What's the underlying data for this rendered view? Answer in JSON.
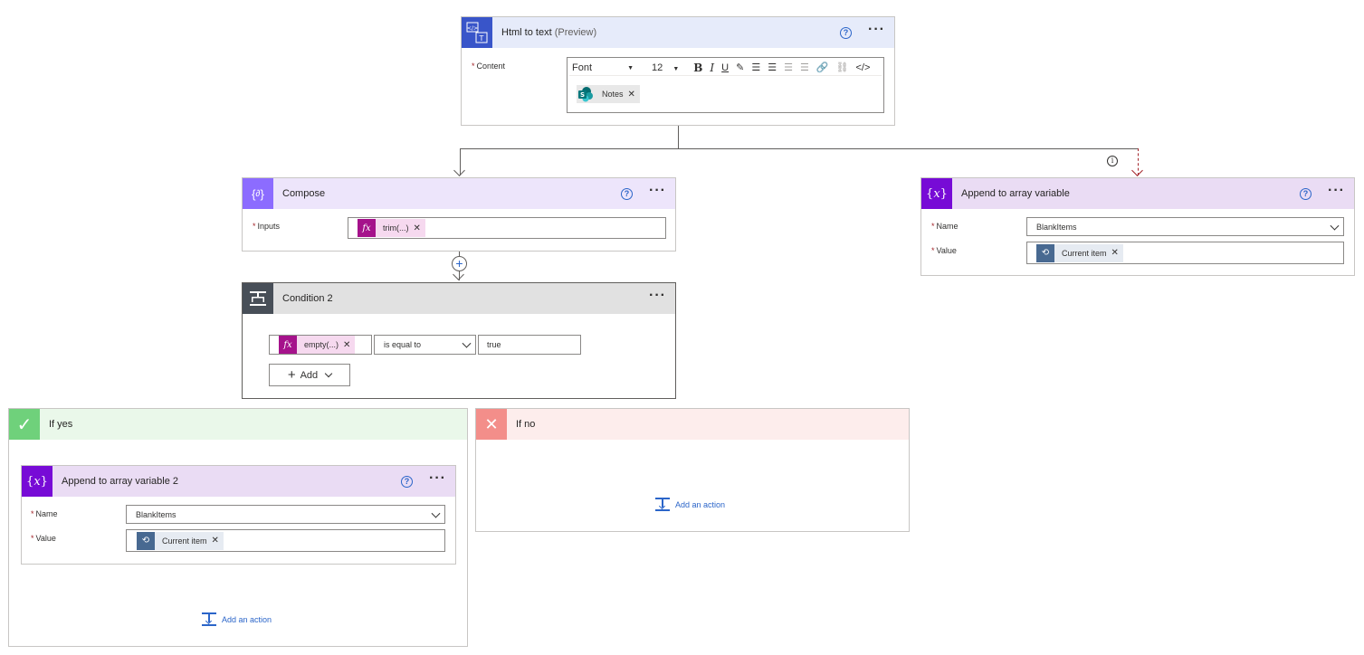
{
  "html_to_text": {
    "title": "Html to text",
    "subtitle": "(Preview)",
    "help_label": "?",
    "content_label": "Content",
    "toolbar": {
      "font": "Font",
      "size": "12",
      "bold": "B",
      "italic": "I",
      "underline": "U",
      "code": "</>"
    },
    "token": {
      "label": "Notes",
      "icon": "sharepoint-icon"
    }
  },
  "compose": {
    "title": "Compose",
    "inputs_label": "Inputs",
    "token": {
      "label": "trim(...)"
    }
  },
  "append_top": {
    "title": "Append to array variable",
    "name_label": "Name",
    "name_value": "BlankItems",
    "value_label": "Value",
    "token": {
      "label": "Current item"
    }
  },
  "condition": {
    "title": "Condition 2",
    "left_token": "empty(...)",
    "operator": "is equal to",
    "right_value": "true",
    "add_label": "Add"
  },
  "if_yes": {
    "label": "If yes",
    "append": {
      "title": "Append to array variable 2",
      "name_label": "Name",
      "name_value": "BlankItems",
      "value_label": "Value",
      "token": {
        "label": "Current item"
      }
    },
    "add_action": "Add an action"
  },
  "if_no": {
    "label": "If no",
    "add_action": "Add an action"
  },
  "colors": {
    "html_header": "#e6ebfa",
    "html_icon": "#3955c9",
    "compose_header": "#ede5fb",
    "compose_icon": "#8c6cff",
    "variable_header": "#eadcf4",
    "variable_icon": "#770bd6",
    "condition_header": "#e1e1e1",
    "condition_icon": "#484f58",
    "yes_header": "#eaf8ea",
    "yes_icon": "#6fd17b",
    "no_header": "#fdedec",
    "no_icon": "#f38e8a",
    "fx": "#a5128b",
    "loop": "#486991",
    "link": "#2b65c9",
    "error_arrow": "#a4262c"
  }
}
